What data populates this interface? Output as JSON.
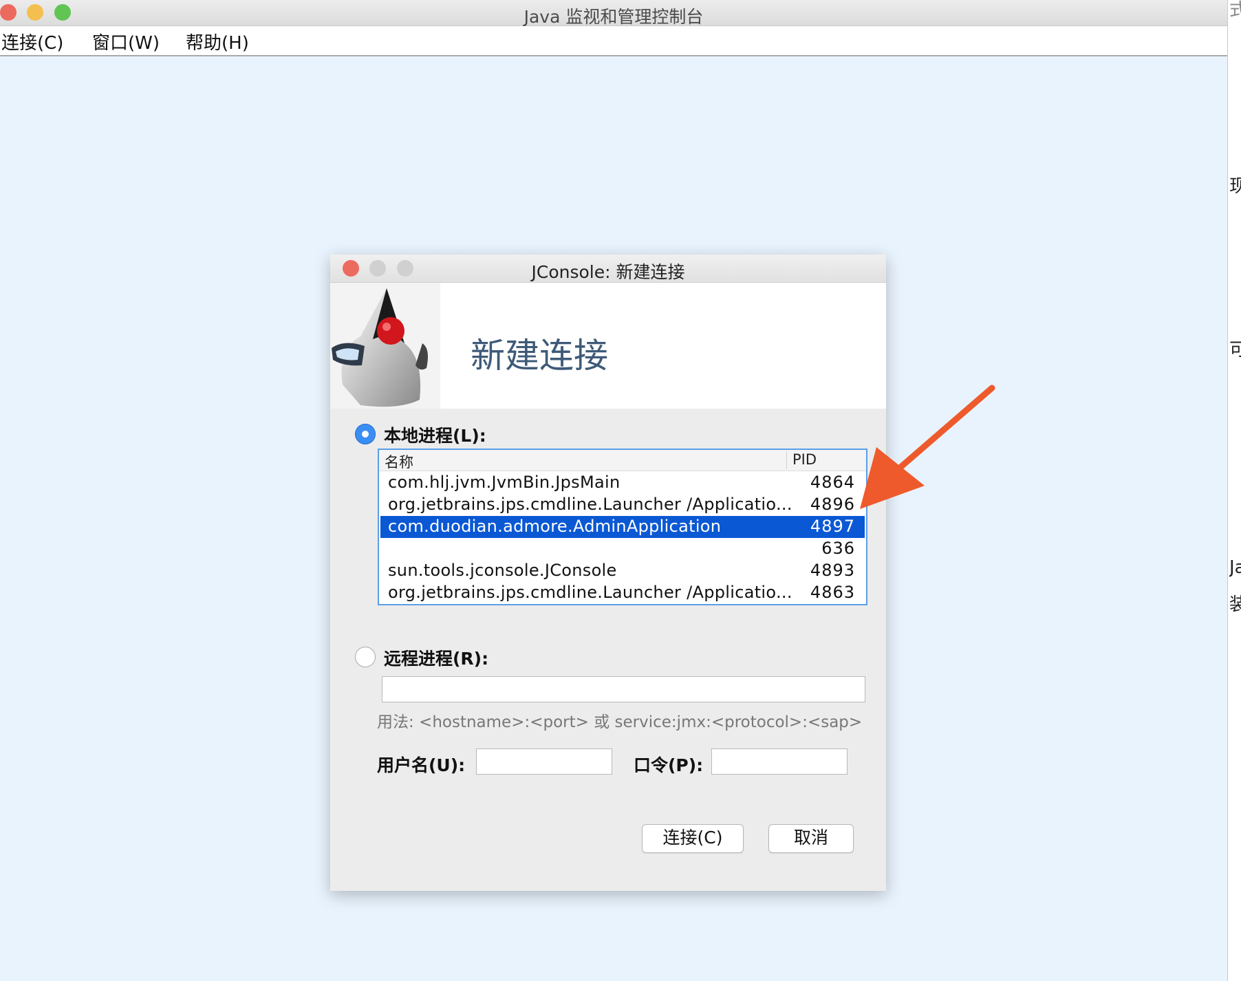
{
  "window": {
    "title": "Java 监视和管理控制台",
    "controls": {
      "close_color": "#ed6a5e",
      "minimize_color": "#f5bf4f",
      "zoom_color": "#61c554"
    }
  },
  "menubar": {
    "items": [
      "连接(C)",
      "窗口(W)",
      "帮助(H)"
    ]
  },
  "right_strip": {
    "glyphs": [
      "式印",
      "现全",
      "可视",
      "Ja",
      "装"
    ]
  },
  "dialog": {
    "title": "JConsole: 新建连接",
    "banner_title": "新建连接",
    "logo_icon": "java-duke-icon",
    "local": {
      "label": "本地进程(L):",
      "selected": true,
      "columns": {
        "name": "名称",
        "pid": "PID"
      },
      "rows": [
        {
          "name": "com.hlj.jvm.JvmBin.JpsMain",
          "pid": "4864"
        },
        {
          "name": "org.jetbrains.jps.cmdline.Launcher /Applicatio...",
          "pid": "4896"
        },
        {
          "name": "com.duodian.admore.AdminApplication",
          "pid": "4897"
        },
        {
          "name": "",
          "pid": "636"
        },
        {
          "name": "sun.tools.jconsole.JConsole",
          "pid": "4893"
        },
        {
          "name": "org.jetbrains.jps.cmdline.Launcher /Applicatio...",
          "pid": "4863"
        }
      ],
      "selected_index": 2,
      "selection_color": "#0b58d4"
    },
    "remote": {
      "label": "远程进程(R):",
      "selected": false,
      "address_value": "",
      "usage": "用法: <hostname>:<port> 或 service:jmx:<protocol>:<sap>",
      "username_label": "用户名(U):",
      "username_value": "",
      "password_label": "口令(P):",
      "password_value": ""
    },
    "buttons": {
      "connect": "连接(C)",
      "cancel": "取消"
    }
  },
  "annotation": {
    "arrow_color": "#ee5a2c",
    "arrow_icon": "arrow-annotation-icon"
  }
}
